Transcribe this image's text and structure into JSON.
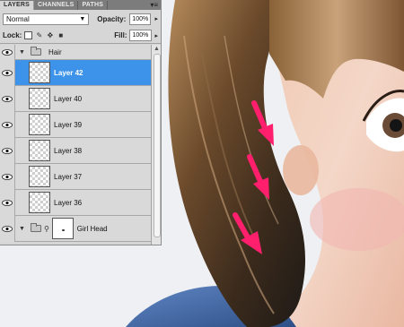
{
  "panel": {
    "tabs": [
      "LAYERS",
      "CHANNELS",
      "PATHS"
    ],
    "menu_icon": "panel-menu-icon",
    "blend_mode": "Normal",
    "opacity_label": "Opacity:",
    "opacity_value": "100%",
    "lock_label": "Lock:",
    "fill_label": "Fill:",
    "fill_value": "100%"
  },
  "layers": {
    "group_hair": "Hair",
    "items": [
      "Layer 42",
      "Layer 40",
      "Layer 39",
      "Layer 38",
      "Layer 37",
      "Layer 36"
    ],
    "selected": "Layer 42",
    "group_head": "Girl Head"
  },
  "colors": {
    "selection": "#3d93e9",
    "arrow": "#ff1f6c",
    "panel_bg": "#d6d6d6"
  }
}
